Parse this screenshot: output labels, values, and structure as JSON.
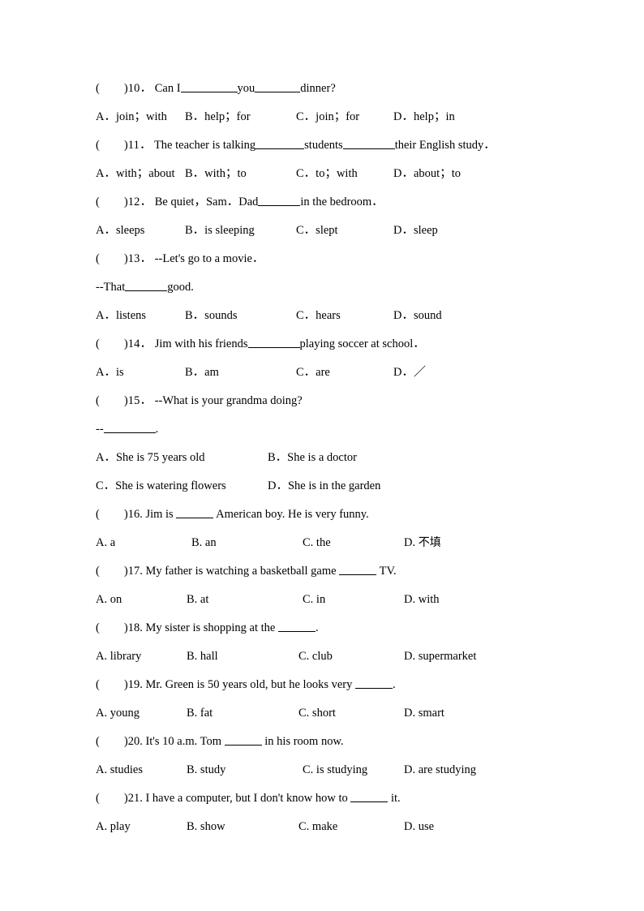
{
  "document": {
    "type": "english-multiple-choice-worksheet",
    "paper_size": "A4",
    "questions": [
      {
        "id": "q10",
        "number": "10",
        "bracket_open": "(",
        "bracket_close": ")",
        "punct_style": "fullwidth",
        "stem_parts": [
          {
            "text": "Can I"
          },
          {
            "blank": "w70"
          },
          {
            "text": "you"
          },
          {
            "blank": "w56"
          },
          {
            "text": "dinner?"
          }
        ],
        "options": [
          {
            "letter": "A",
            "text": "join；with"
          },
          {
            "letter": "B",
            "text": "help；for"
          },
          {
            "letter": "C",
            "text": "join；for"
          },
          {
            "letter": "D",
            "text": "help；in"
          }
        ]
      },
      {
        "id": "q11",
        "number": "11",
        "bracket_open": "(",
        "bracket_close": ")",
        "punct_style": "fullwidth",
        "stem_parts": [
          {
            "text": "The teacher is talking"
          },
          {
            "blank": "w60"
          },
          {
            "text": "students"
          },
          {
            "blank": "w64"
          },
          {
            "text": "their English study．"
          }
        ],
        "options": [
          {
            "letter": "A",
            "text": "with；about"
          },
          {
            "letter": "B",
            "text": "with；to"
          },
          {
            "letter": "C",
            "text": "to；with"
          },
          {
            "letter": "D",
            "text": "about；to"
          }
        ]
      },
      {
        "id": "q12",
        "number": "12",
        "bracket_open": "(",
        "bracket_close": ")",
        "punct_style": "fullwidth",
        "stem_parts": [
          {
            "text": "Be quiet，Sam．Dad"
          },
          {
            "blank": "w52"
          },
          {
            "text": "in the bedroom．"
          }
        ],
        "options": [
          {
            "letter": "A",
            "text": "sleeps"
          },
          {
            "letter": "B",
            "text": "is sleeping"
          },
          {
            "letter": "C",
            "text": "slept"
          },
          {
            "letter": "D",
            "text": "sleep"
          }
        ]
      },
      {
        "id": "q13",
        "number": "13",
        "bracket_open": "(",
        "bracket_close": ")",
        "punct_style": "fullwidth",
        "stem_parts": [
          {
            "text": "--Let's go to a movie．"
          }
        ],
        "continuation_parts": [
          {
            "text": "--That"
          },
          {
            "blank": "w52"
          },
          {
            "text": "good."
          }
        ],
        "options": [
          {
            "letter": "A",
            "text": "listens"
          },
          {
            "letter": "B",
            "text": "sounds"
          },
          {
            "letter": "C",
            "text": "hears"
          },
          {
            "letter": "D",
            "text": "sound"
          }
        ]
      },
      {
        "id": "q14",
        "number": "14",
        "bracket_open": "(",
        "bracket_close": ")",
        "punct_style": "fullwidth",
        "stem_parts": [
          {
            "text": "Jim with his friends"
          },
          {
            "blank": "w64"
          },
          {
            "text": "playing soccer at school．"
          }
        ],
        "options": [
          {
            "letter": "A",
            "text": "is"
          },
          {
            "letter": "B",
            "text": "am"
          },
          {
            "letter": "C",
            "text": "are"
          },
          {
            "letter": "D",
            "text": "／"
          }
        ]
      },
      {
        "id": "q15",
        "number": "15",
        "bracket_open": "(",
        "bracket_close": ")",
        "punct_style": "fullwidth",
        "stem_parts": [
          {
            "text": "--What is your grandma doing?"
          }
        ],
        "continuation_parts": [
          {
            "text": "--"
          },
          {
            "blank": "w64"
          },
          {
            "text": "."
          }
        ],
        "options": [
          {
            "letter": "A",
            "text": "She is 75 years old"
          },
          {
            "letter": "B",
            "text": "She is a doctor"
          },
          {
            "letter": "C",
            "text": "She is watering flowers"
          },
          {
            "letter": "D",
            "text": "She is in the garden"
          }
        ],
        "option_layout": "two-column"
      },
      {
        "id": "q16",
        "number": "16",
        "bracket_open": "(",
        "bracket_close": ")",
        "punct_style": "ascii",
        "stem_parts": [
          {
            "text": "Jim is"
          },
          {
            "blank": "w46"
          },
          {
            "text": "American boy. He is very funny."
          }
        ],
        "options": [
          {
            "letter": "A",
            "text": "a"
          },
          {
            "letter": "B",
            "text": "an"
          },
          {
            "letter": "C",
            "text": "the"
          },
          {
            "letter": "D",
            "text": "不填",
            "cjk": true
          }
        ]
      },
      {
        "id": "q17",
        "number": "17",
        "bracket_open": "(",
        "bracket_close": ")",
        "punct_style": "ascii",
        "stem_parts": [
          {
            "text": "My father is watching a basketball game"
          },
          {
            "blank": "w46"
          },
          {
            "text": "TV."
          }
        ],
        "options": [
          {
            "letter": "A",
            "text": "on"
          },
          {
            "letter": "B",
            "text": "at"
          },
          {
            "letter": "C",
            "text": "in"
          },
          {
            "letter": "D",
            "text": "with"
          }
        ]
      },
      {
        "id": "q18",
        "number": "18",
        "bracket_open": "(",
        "bracket_close": ")",
        "punct_style": "ascii",
        "stem_parts": [
          {
            "text": "My sister is shopping at the"
          },
          {
            "blank": "w46"
          },
          {
            "text": "."
          }
        ],
        "options": [
          {
            "letter": "A",
            "text": "library"
          },
          {
            "letter": "B",
            "text": "hall"
          },
          {
            "letter": "C",
            "text": "club"
          },
          {
            "letter": "D",
            "text": "supermarket"
          }
        ]
      },
      {
        "id": "q19",
        "number": "19",
        "bracket_open": "(",
        "bracket_close": ")",
        "punct_style": "ascii",
        "stem_parts": [
          {
            "text": "Mr. Green is 50 years old, but he looks very"
          },
          {
            "blank": "w46"
          },
          {
            "text": "."
          }
        ],
        "options": [
          {
            "letter": "A",
            "text": "young"
          },
          {
            "letter": "B",
            "text": "fat"
          },
          {
            "letter": "C",
            "text": "short"
          },
          {
            "letter": "D",
            "text": "smart"
          }
        ]
      },
      {
        "id": "q20",
        "number": "20",
        "bracket_open": "(",
        "bracket_close": ")",
        "punct_style": "ascii",
        "stem_parts": [
          {
            "text": "It's 10 a.m. Tom"
          },
          {
            "blank": "w46"
          },
          {
            "text": "in his room now."
          }
        ],
        "options": [
          {
            "letter": "A",
            "text": "studies"
          },
          {
            "letter": "B",
            "text": "study"
          },
          {
            "letter": "C",
            "text": "is studying"
          },
          {
            "letter": "D",
            "text": "are studying"
          }
        ]
      },
      {
        "id": "q21",
        "number": "21",
        "bracket_open": "(",
        "bracket_close": ")",
        "punct_style": "ascii",
        "stem_parts": [
          {
            "text": "I have a computer, but I don't know how to"
          },
          {
            "blank": "w46"
          },
          {
            "text": "it."
          }
        ],
        "options": [
          {
            "letter": "A",
            "text": "play"
          },
          {
            "letter": "B",
            "text": "show"
          },
          {
            "letter": "C",
            "text": "make"
          },
          {
            "letter": "D",
            "text": "use"
          }
        ]
      }
    ]
  }
}
